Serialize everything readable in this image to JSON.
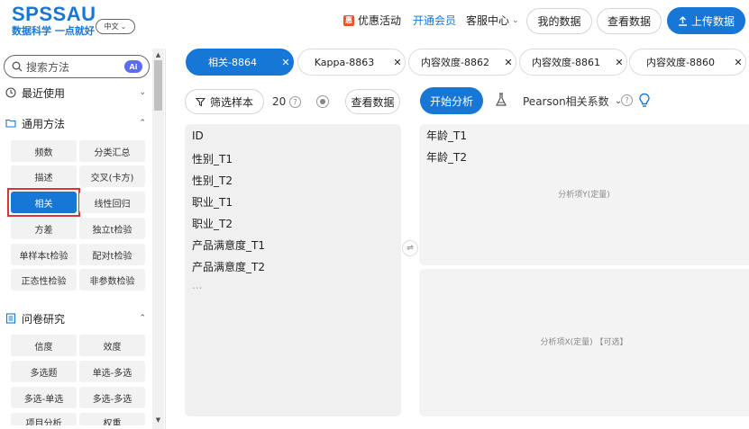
{
  "header": {
    "logo": "SPSSAU",
    "slogan": "数据科学 一点就好",
    "language": "中文",
    "promo_label": "优惠活动",
    "vip_label": "开通会员",
    "service_label": "客服中心",
    "my_data_label": "我的数据",
    "view_data_label": "查看数据",
    "upload_label": "上传数据"
  },
  "sidebar": {
    "search_placeholder": "搜索方法",
    "ai_badge": "Ai",
    "recent_label": "最近使用",
    "general_label": "通用方法",
    "general_items": [
      "频数",
      "分类汇总",
      "描述",
      "交叉(卡方)",
      "相关",
      "线性回归",
      "方差",
      "独立t检验",
      "单样本t检验",
      "配对t检验",
      "正态性检验",
      "非参数检验"
    ],
    "active_item": "相关",
    "survey_label": "问卷研究",
    "survey_items": [
      "信度",
      "效度",
      "多选题",
      "单选-多选",
      "多选-单选",
      "多选-多选",
      "项目分析",
      "权重"
    ]
  },
  "tabs": [
    {
      "label": "相关-8864",
      "active": true
    },
    {
      "label": "Kappa-8863",
      "active": false
    },
    {
      "label": "内容效度-8862",
      "active": false
    },
    {
      "label": "内容效度-8861",
      "active": false
    },
    {
      "label": "内容效度-8860",
      "active": false
    }
  ],
  "toolbar": {
    "filter_label": "筛选样本",
    "sample_count": "20",
    "view_data_label": "查看数据",
    "start_label": "开始分析",
    "method_label": "Pearson相关系数"
  },
  "variables": [
    "ID",
    "性别_T1",
    "性别_T2",
    "职业_T1",
    "职业_T2",
    "产品满意度_T1",
    "产品满意度_T2",
    "..."
  ],
  "zone_y": {
    "items": [
      "年龄_T1",
      "年龄_T2"
    ],
    "hint": "分析项Y(定量)"
  },
  "zone_x": {
    "hint": "分析项X(定量) 【可选】"
  },
  "colors": {
    "primary": "#1677d6",
    "highlight_outline": "#e03232"
  }
}
